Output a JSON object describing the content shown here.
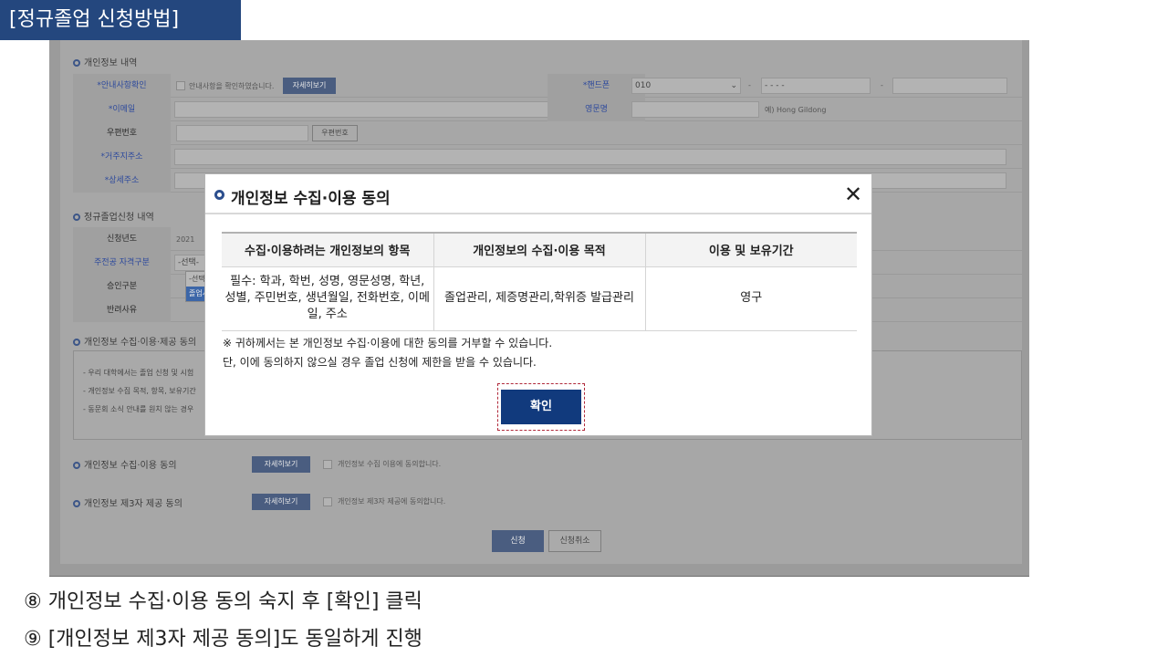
{
  "slide": {
    "title": "[정규졸업 신청방법]",
    "captions": [
      "⑧ 개인정보 수집·이용 동의 숙지 후 [확인] 클릭",
      "⑨ [개인정보 제3자 제공 동의]도 동일하게 진행"
    ]
  },
  "form": {
    "section_personal": "개인정보 내역",
    "notice_label": "*안내사항확인",
    "notice_check_text": "안내사항을 확인하였습니다.",
    "detail_button": "자세히보기",
    "phone_label": "*핸드폰",
    "phone_prefix": "010",
    "phone_middle": "- - - -",
    "dash": "-",
    "email_label": "*이메일",
    "english_name_label": "영문명",
    "english_name_example": "예) Hong Gildong",
    "zip_label": "우편번호",
    "zip_button": "우편번호",
    "address_label": "*거주지주소",
    "detail_address_label": "*상세주소",
    "section_apply": "정규졸업신청 내역",
    "year_label": "신청년도",
    "year_value": "2021",
    "major_label": "주전공 자격구분",
    "select_default": "-선택-",
    "option_grad": "졸업시",
    "approval_label": "승인구분",
    "reject_label": "반려사유",
    "section_consent": "개인정보 수집·이용·제공 동의",
    "notice_lines": [
      "- 우리 대학에서는 졸업 신청 및 시험",
      "- 개인정보 수집 목적, 항목, 보유기간",
      "- 동문회 소식 안내를 원치 않는 경우"
    ],
    "consent_collect_label": "개인정보 수집·이용 동의",
    "consent_collect_check": "개인정보 수집 이용에 동의합니다.",
    "consent_third_label": "개인정보 제3자 제공 동의",
    "consent_third_check": "개인정보 제3자 제공에 동의합니다.",
    "apply_button": "신청",
    "cancel_button": "신청취소"
  },
  "modal": {
    "title": "개인정보 수집·이용 동의",
    "close_icon": "close-icon",
    "table": {
      "headers": [
        "수집·이용하려는 개인정보의 항목",
        "개인정보의 수집·이용 목적",
        "이용 및 보유기간"
      ],
      "rows": [
        [
          "필수: 학과, 학번, 성명, 영문성명, 학년, 성별, 주민번호, 생년월일, 전화번호, 이메일, 주소",
          "졸업관리, 제증명관리,학위증 발급관리",
          "영구"
        ]
      ]
    },
    "note_1": "※ 귀하께서는 본 개인정보 수집·이용에 대한 동의를 거부할 수 있습니다.",
    "note_2": "단, 이에 동의하지 않으실 경우 졸업 신청에 제한을 받을 수 있습니다.",
    "confirm_button": "확인"
  },
  "colors": {
    "title_bar": "#24477e",
    "confirm_button": "#113a7d",
    "highlight": "#b0293a"
  }
}
